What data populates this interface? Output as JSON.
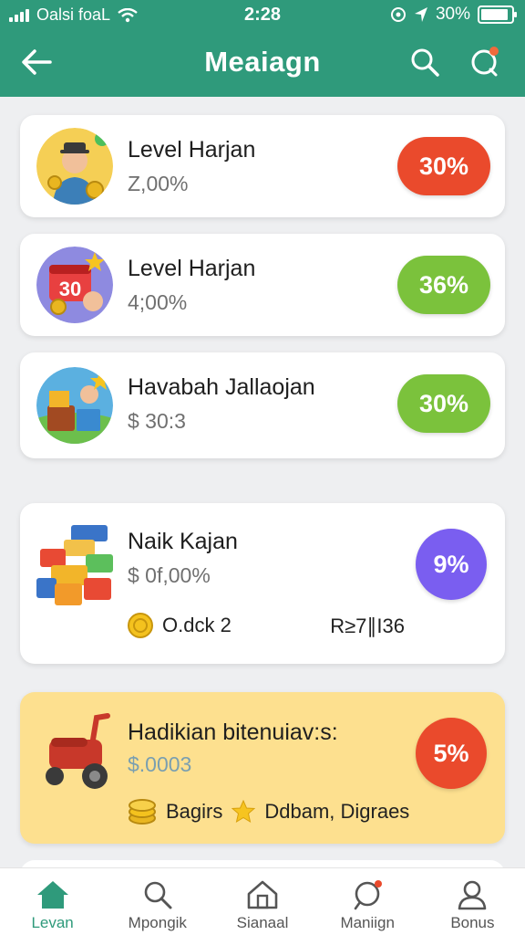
{
  "status_bar": {
    "carrier": "Oalsi foaL",
    "time": "2:28",
    "battery": "30%",
    "battery_level": 0.9
  },
  "header": {
    "title": "Meaiagn"
  },
  "cards": [
    {
      "title": "Level Harjan",
      "subtitle": "Z,00%",
      "badge": "30%",
      "badge_color": "#ea4a2c"
    },
    {
      "title": "Level Harjan",
      "subtitle": "4;00%",
      "badge": "36%",
      "badge_color": "#7bc23c",
      "avatar_number": "30"
    },
    {
      "title": "Havabah Jallaojan",
      "subtitle": "$ 30:3",
      "badge": "30%",
      "badge_color": "#7bc23c"
    },
    {
      "title": "Naik Kajan",
      "subtitle": "$ 0f,00%",
      "badge": "9%",
      "badge_color": "#7a5ef0",
      "extra_left": "O.dck 2",
      "extra_right": "R≥7∥I36"
    },
    {
      "title": "Hadikian bitenuiav:s:",
      "subtitle": "$.0003",
      "badge": "5%",
      "badge_color": "#ea4a2c",
      "extra_left": "Bagirs",
      "extra_right": "Ddbam, Digraes"
    }
  ],
  "tabs": [
    {
      "label": "Levan",
      "icon": "home-icon"
    },
    {
      "label": "Mpongik",
      "icon": "search-icon"
    },
    {
      "label": "Sianaal",
      "icon": "house-icon"
    },
    {
      "label": "Maniign",
      "icon": "chat-icon"
    },
    {
      "label": "Bonus",
      "icon": "profile-icon"
    }
  ],
  "colors": {
    "primary": "#2f9a7b",
    "red": "#ea4a2c",
    "green": "#7bc23c",
    "purple": "#7a5ef0",
    "highlight_card": "#fde08f"
  }
}
